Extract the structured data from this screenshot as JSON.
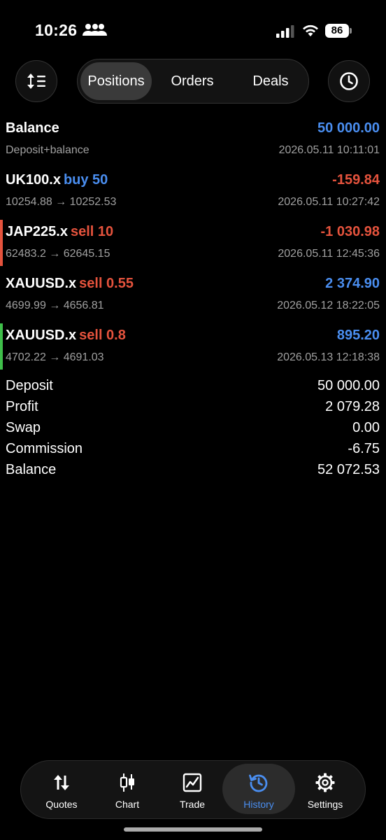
{
  "status_bar": {
    "time": "10:26",
    "battery": "86"
  },
  "segments": {
    "positions": "Positions",
    "orders": "Orders",
    "deals": "Deals",
    "active": "Positions"
  },
  "rows": [
    {
      "symbol": "Balance",
      "direction": "",
      "amount": "50 000.00",
      "amount_color": "blue",
      "detail": "Deposit+balance",
      "date": "2026.05.11 10:11:01",
      "marker": ""
    },
    {
      "symbol": "UK100.x",
      "direction": "buy 50",
      "dir_color": "blue",
      "amount": "-159.84",
      "amount_color": "red",
      "detail": "10254.88 → 10252.53",
      "date": "2026.05.11 10:27:42",
      "marker": ""
    },
    {
      "symbol": "JAP225.x",
      "direction": "sell 10",
      "dir_color": "red",
      "amount": "-1 030.98",
      "amount_color": "red",
      "detail": "62483.2 → 62645.15",
      "date": "2026.05.11 12:45:36",
      "marker": "#e5533d"
    },
    {
      "symbol": "XAUUSD.x",
      "direction": "sell 0.55",
      "dir_color": "red",
      "amount": "2 374.90",
      "amount_color": "blue",
      "detail": "4699.99 → 4656.81",
      "date": "2026.05.12 18:22:05",
      "marker": ""
    },
    {
      "symbol": "XAUUSD.x",
      "direction": "sell 0.8",
      "dir_color": "red",
      "amount": "895.20",
      "amount_color": "blue",
      "detail": "4702.22 → 4691.03",
      "date": "2026.05.13 12:18:38",
      "marker": "#3fbf4a"
    }
  ],
  "summary": [
    {
      "label": "Deposit",
      "value": "50 000.00"
    },
    {
      "label": "Profit",
      "value": "2 079.28"
    },
    {
      "label": "Swap",
      "value": "0.00"
    },
    {
      "label": "Commission",
      "value": "-6.75"
    },
    {
      "label": "Balance",
      "value": "52 072.53"
    }
  ],
  "tabs": [
    {
      "label": "Quotes",
      "icon": "quotes-icon"
    },
    {
      "label": "Chart",
      "icon": "chart-icon"
    },
    {
      "label": "Trade",
      "icon": "trade-icon"
    },
    {
      "label": "History",
      "icon": "history-icon",
      "active": true
    },
    {
      "label": "Settings",
      "icon": "settings-icon"
    }
  ],
  "colors": {
    "accent": "#4a8ef0",
    "loss": "#e5533d",
    "gain_marker": "#3fbf4a",
    "background": "#000000"
  }
}
